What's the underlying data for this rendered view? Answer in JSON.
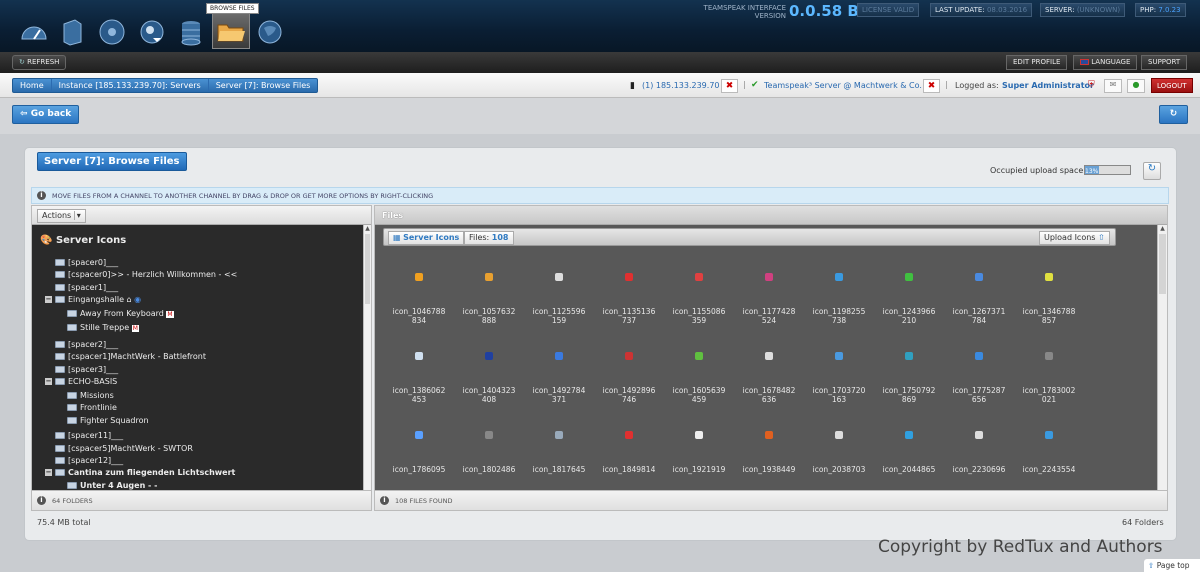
{
  "top": {
    "nav_icons": [
      "dashboard-icon",
      "server-icon",
      "disc-icon",
      "user-group-icon",
      "database-icon",
      "folder-icon",
      "globe-icon"
    ],
    "tooltip": "BROWSE FILES",
    "version_label_line1": "TEAMSPEAK INTERFACE",
    "version_label_line2": "VERSION",
    "version_number": "0.0.58 BE",
    "license": "LICENSE VALID",
    "last_update_label": "LAST UPDATE:",
    "last_update_value": "08.03.2016",
    "server_label": "SERVER:",
    "server_value": "(UNKNOWN)",
    "php_label": "PHP:",
    "php_value": "7.0.23"
  },
  "bar2": {
    "refresh": "REFRESH",
    "edit_profile": "EDIT PROFILE",
    "language": "LANGUAGE",
    "support": "SUPPORT"
  },
  "breadcrumb": [
    "Home",
    "Instance [185.133.239.70]: Servers",
    "Server [7]: Browse Files"
  ],
  "status": {
    "instance": "(1) 185.133.239.70",
    "server": "Teamspeak³ Server @ Machtwerk & Co.",
    "logged_as_label": "Logged as:",
    "logged_as_user": "Super Administrator",
    "logout": "LOGOUT"
  },
  "go_back": "Go back",
  "panel": {
    "title": "Server [7]: Browse Files",
    "occupied_label": "Occupied upload space",
    "occupied_value": "13%",
    "info": "MOVE FILES FROM A CHANNEL TO ANOTHER CHANNEL BY DRAG & DROP OR GET MORE OPTIONS BY RIGHT-CLICKING",
    "actions": "Actions",
    "files_header": "Files",
    "left_footer": "64 FOLDERS",
    "right_footer": "108 FILES FOUND",
    "total": "75.4 MB total",
    "folders_total": "64 Folders"
  },
  "tree": {
    "root": "Server Icons",
    "nodes": [
      "[spacer0]___",
      "[cspacer0]>> - Herzlich Willkommen - <<",
      "[spacer1]___",
      "Eingangshalle",
      "Away From Keyboard",
      "Stille Treppe",
      "[spacer2]___",
      "[cspacer1]MachtWerk - Battlefront",
      "[spacer3]___",
      "ECHO-BASIS",
      "Missions",
      "Frontlinie",
      "Fighter Squadron",
      "[spacer11]___",
      "[cspacer5]MachtWerk - SWTOR",
      "[spacer12]___",
      "Cantina zum fliegenden Lichtschwert",
      "Unter 4 Augen - -"
    ]
  },
  "grid": {
    "server_icons_btn": "Server Icons",
    "files_label": "Files:",
    "files_count": "108",
    "upload": "Upload Icons",
    "files": [
      [
        "icon_1046788",
        "834"
      ],
      [
        "icon_1057632",
        "888"
      ],
      [
        "icon_1125596",
        "159"
      ],
      [
        "icon_1135136",
        "737"
      ],
      [
        "icon_1155086",
        "359"
      ],
      [
        "icon_1177428",
        "524"
      ],
      [
        "icon_1198255",
        "738"
      ],
      [
        "icon_1243966",
        "210"
      ],
      [
        "icon_1267371",
        "784"
      ],
      [
        "icon_1346788",
        "857"
      ],
      [
        "icon_1386062",
        "453"
      ],
      [
        "icon_1404323",
        "408"
      ],
      [
        "icon_1492784",
        "371"
      ],
      [
        "icon_1492896",
        "746"
      ],
      [
        "icon_1605639",
        "459"
      ],
      [
        "icon_1678482",
        "636"
      ],
      [
        "icon_1703720",
        "163"
      ],
      [
        "icon_1750792",
        "869"
      ],
      [
        "icon_1775287",
        "656"
      ],
      [
        "icon_1783002",
        "021"
      ],
      [
        "icon_1786095",
        ""
      ],
      [
        "icon_1802486",
        ""
      ],
      [
        "icon_1817645",
        ""
      ],
      [
        "icon_1849814",
        ""
      ],
      [
        "icon_1921919",
        ""
      ],
      [
        "icon_1938449",
        ""
      ],
      [
        "icon_2038703",
        ""
      ],
      [
        "icon_2044865",
        ""
      ],
      [
        "icon_2230696",
        ""
      ],
      [
        "icon_2243554",
        ""
      ]
    ],
    "icon_colors": [
      "#f0a020",
      "#e8a030",
      "#dddddd",
      "#e03030",
      "#e04040",
      "#d04080",
      "#3a9ae0",
      "#40c040",
      "#4a8ae0",
      "#e0e040",
      "#d0e0f0",
      "#2040a0",
      "#3a7ae0",
      "#cc3333",
      "#60c040",
      "#dddddd",
      "#4a9ae0",
      "#30a0c0",
      "#3a8ae0",
      "#888888",
      "#5aa0ff",
      "#888888",
      "#9ab",
      "#e03030",
      "#eeeeee",
      "#e06020",
      "#dddddd",
      "#30a0e0",
      "#dddddd",
      "#3a9ae0"
    ]
  },
  "footer": {
    "copyright": "Copyright by RedTux and Authors",
    "page_top": "Page top"
  }
}
